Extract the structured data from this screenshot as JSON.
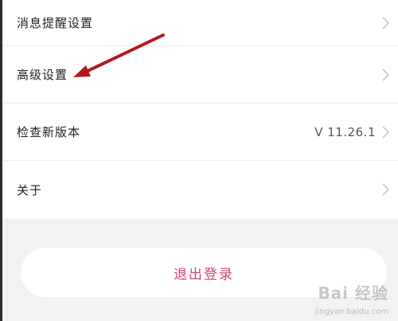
{
  "settings": {
    "items": [
      {
        "label": "消息提醒设置",
        "value": ""
      },
      {
        "label": "高级设置",
        "value": ""
      },
      {
        "label": "检查新版本",
        "value": "V 11.26.1"
      },
      {
        "label": "关于",
        "value": ""
      }
    ]
  },
  "logout": {
    "label": "退出登录"
  },
  "watermark": {
    "main": "Bai 经验",
    "sub": "jingyan.baidu.com"
  },
  "colors": {
    "accent": "#d2456a",
    "annotation_arrow": "#b3171c",
    "background": "#f2f2f4"
  }
}
